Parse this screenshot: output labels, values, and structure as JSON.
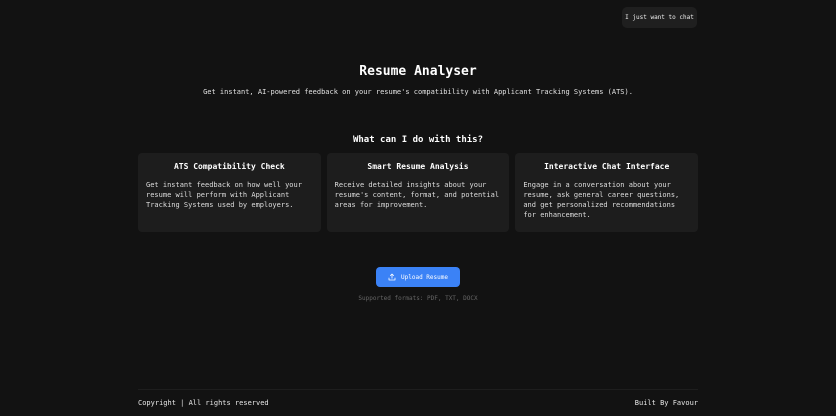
{
  "header": {
    "chat_button_label": "I just want to chat"
  },
  "hero": {
    "title": "Resume Analyser",
    "subtitle": "Get instant, AI-powered feedback on your resume's compatibility with Applicant Tracking Systems (ATS)."
  },
  "features": {
    "heading": "What can I do with this?",
    "cards": [
      {
        "title": "ATS Compatibility Check",
        "text": "Get instant feedback on how well your resume will perform with Applicant Tracking Systems used by employers."
      },
      {
        "title": "Smart Resume Analysis",
        "text": "Receive detailed insights about your resume's content, format, and potential areas for improvement."
      },
      {
        "title": "Interactive Chat Interface",
        "text": "Engage in a conversation about your resume, ask general career questions, and get personalized recommendations for enhancement."
      }
    ]
  },
  "upload": {
    "button_label": "Upload Resume",
    "icon": "upload-icon",
    "formats": "Supported formats: PDF, TXT, DOCX"
  },
  "footer": {
    "copyright": "Copyright | All rights reserved",
    "credit": "Built By Favour"
  },
  "colors": {
    "background": "#121212",
    "card": "#1d1d1d",
    "accent": "#3b82f6"
  }
}
